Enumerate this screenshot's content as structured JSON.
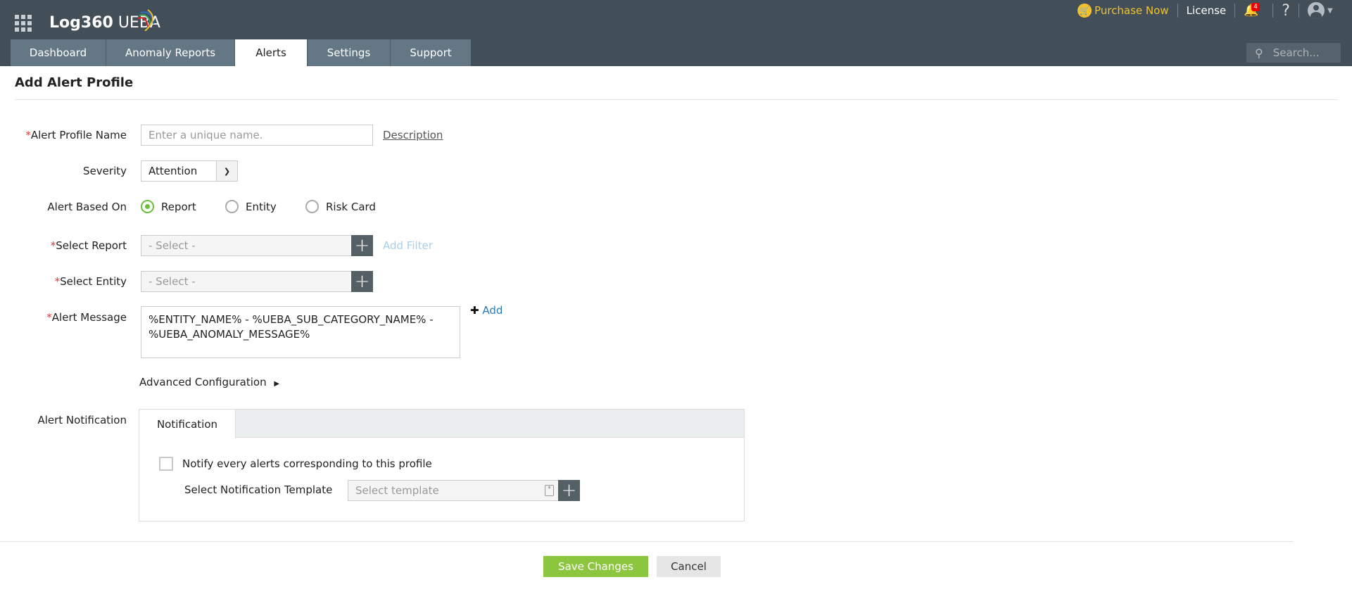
{
  "header": {
    "logo_main": "Log360",
    "logo_sub": "UEBA",
    "purchase": "Purchase Now",
    "license": "License",
    "notif_count": "4",
    "help": "?",
    "search_placeholder": "Search..."
  },
  "tabs": [
    {
      "label": "Dashboard"
    },
    {
      "label": "Anomaly Reports"
    },
    {
      "label": "Alerts"
    },
    {
      "label": "Settings"
    },
    {
      "label": "Support"
    }
  ],
  "page": {
    "title": "Add Alert Profile"
  },
  "form": {
    "profile_name_label": "Alert Profile Name",
    "profile_name_placeholder": "Enter a unique name.",
    "description_link": "Description",
    "severity_label": "Severity",
    "severity_value": "Attention",
    "based_on_label": "Alert Based On",
    "based_on_options": [
      "Report",
      "Entity",
      "Risk Card"
    ],
    "select_report_label": "Select Report",
    "select_report_value": "- Select -",
    "add_filter": "Add Filter",
    "select_entity_label": "Select Entity",
    "select_entity_value": "- Select -",
    "message_label": "Alert Message",
    "message_value": "%ENTITY_NAME% - %UEBA_SUB_CATEGORY_NAME% - %UEBA_ANOMALY_MESSAGE%",
    "add_label": "Add",
    "advanced": "Advanced Configuration",
    "notification_label": "Alert Notification",
    "notification_tab": "Notification",
    "notify_checkbox": "Notify every alerts corresponding to this profile",
    "template_label": "Select Notification Template",
    "template_placeholder": "Select template"
  },
  "actions": {
    "save": "Save Changes",
    "cancel": "Cancel"
  },
  "colors": {
    "header": "#434f58",
    "tab": "#637884",
    "save": "#8cc63f",
    "purchase": "#f2c12e",
    "radio": "#6cbf3c"
  }
}
